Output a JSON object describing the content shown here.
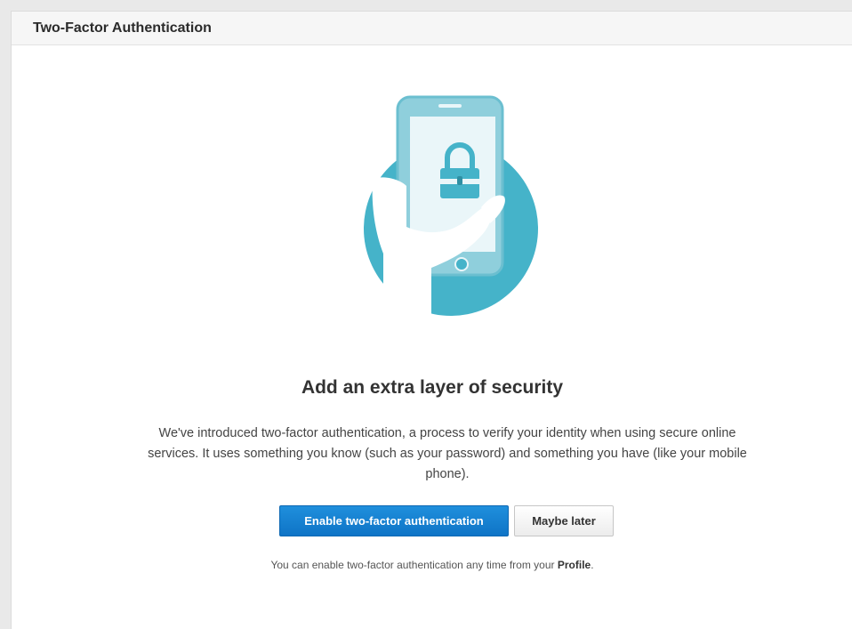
{
  "panel": {
    "title": "Two-Factor Authentication"
  },
  "illustration": {
    "icon": "phone-lock-icon",
    "accent_color": "#45b3c9"
  },
  "content": {
    "headline": "Add an extra layer of security",
    "body": "We've introduced two-factor authentication, a process to verify your identity when using secure online services. It uses something you know (such as your password) and something you have (like your mobile phone)."
  },
  "actions": {
    "enable_label": "Enable two-factor authentication",
    "later_label": "Maybe later"
  },
  "footnote": {
    "text": "You can enable two-factor authentication any time from your",
    "link_label": "Profile",
    "suffix": "."
  },
  "colors": {
    "primary_button": "#1580d1",
    "header_bg": "#f6f6f6"
  }
}
